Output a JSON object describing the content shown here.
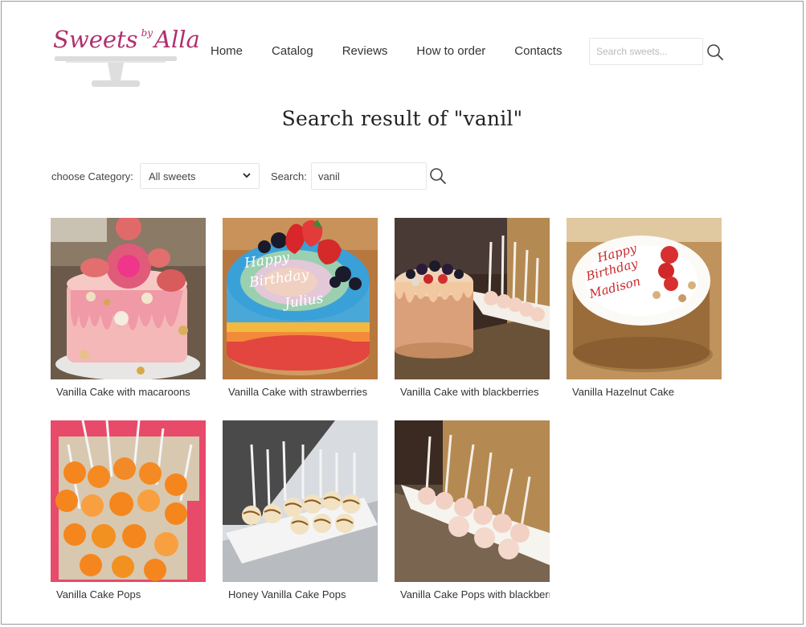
{
  "header": {
    "logo": {
      "text_main": "Sweets",
      "text_by": "by",
      "text_name": "Alla"
    },
    "nav": [
      {
        "label": "Home"
      },
      {
        "label": "Catalog"
      },
      {
        "label": "Reviews"
      },
      {
        "label": "How to order"
      },
      {
        "label": "Contacts"
      }
    ],
    "search": {
      "placeholder": "Search sweets...",
      "icon": "search-icon"
    }
  },
  "page_title": "Search result of \"vanil\"",
  "filter": {
    "category_label": "choose Category:",
    "category_value": "All sweets",
    "search_label": "Search:",
    "search_value": "vanil",
    "icon": "search-icon"
  },
  "products": [
    {
      "name": "Vanilla Cake with macaroons"
    },
    {
      "name": "Vanilla Cake with strawberries",
      "image_text": [
        "Happy",
        "Birthday",
        "Julius"
      ]
    },
    {
      "name": "Vanilla Cake with blackberries"
    },
    {
      "name": "Vanilla Hazelnut Cake",
      "image_text": [
        "Happy",
        "Birthday",
        "Madison"
      ]
    },
    {
      "name": "Vanilla Cake Pops"
    },
    {
      "name": "Honey Vanilla Cake Pops"
    },
    {
      "name": "Vanilla Cake Pops with blackberries"
    }
  ],
  "colors": {
    "logo": "#b0306e",
    "text": "#333333",
    "border": "#e6e6e6"
  }
}
